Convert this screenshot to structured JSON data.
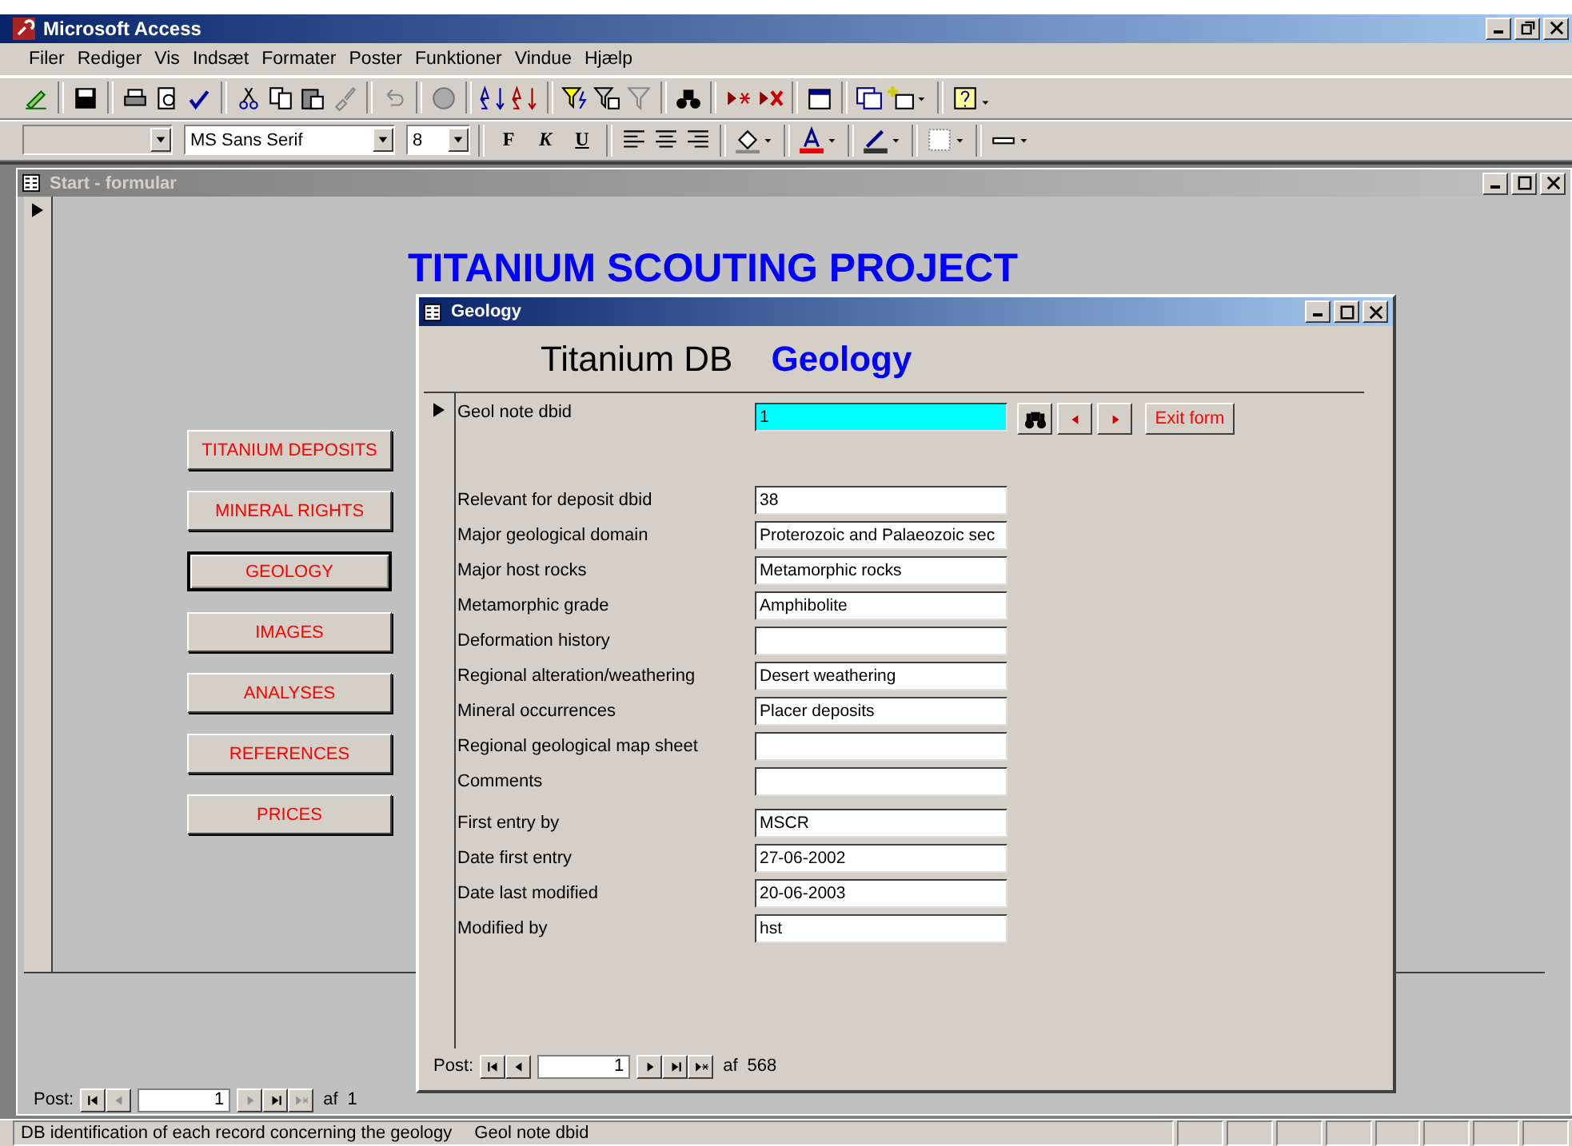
{
  "app_window": {
    "title": "Microsoft Access"
  },
  "menu": [
    "Filer",
    "Rediger",
    "Vis",
    "Indsæt",
    "Formater",
    "Poster",
    "Funktioner",
    "Vindue",
    "Hjælp"
  ],
  "format_toolbar": {
    "font": "MS Sans Serif",
    "size": "8",
    "style_buttons": [
      {
        "kind": "bold",
        "label": "F"
      },
      {
        "kind": "italic",
        "label": "K"
      },
      {
        "kind": "underline",
        "label": "U"
      }
    ]
  },
  "start_form": {
    "title": "Start - formular",
    "heading": "TITANIUM SCOUTING PROJECT",
    "buttons": [
      {
        "label": "TITANIUM DEPOSITS",
        "selected": false
      },
      {
        "label": "MINERAL RIGHTS",
        "selected": false
      },
      {
        "label": "GEOLOGY",
        "selected": true
      },
      {
        "label": "IMAGES",
        "selected": false
      },
      {
        "label": "ANALYSES",
        "selected": false
      },
      {
        "label": "REFERENCES",
        "selected": false
      },
      {
        "label": "PRICES",
        "selected": false
      }
    ],
    "navigator": {
      "label": "Post:",
      "record": "1",
      "of": "af",
      "total": "1",
      "buttons": [
        {
          "kind": "first",
          "disabled": false
        },
        {
          "kind": "prev",
          "disabled": true
        },
        {
          "kind": "next",
          "disabled": true
        },
        {
          "kind": "last",
          "disabled": false
        },
        {
          "kind": "new",
          "disabled": true
        }
      ]
    }
  },
  "geology_form": {
    "title": "Geology",
    "heading": "Titanium DB",
    "subheading": "Geology",
    "key_field": {
      "label": "Geol note dbid",
      "value": "1"
    },
    "exit_button": "Exit form",
    "fields": [
      {
        "label": "Relevant for deposit dbid",
        "value": "38"
      },
      {
        "label": "Major geological domain",
        "value": "Proterozoic and Palaeozoic sec"
      },
      {
        "label": "Major host rocks",
        "value": "Metamorphic rocks"
      },
      {
        "label": "Metamorphic grade",
        "value": "Amphibolite"
      },
      {
        "label": "Deformation history"
      },
      {
        "label": "Regional alteration/weathering",
        "value": "Desert weathering"
      },
      {
        "label": "Mineral occurrences",
        "value": "Placer deposits"
      },
      {
        "label": "Regional geological map sheet"
      },
      {
        "label": "Comments"
      },
      {
        "label": "First entry by",
        "value": "MSCR"
      },
      {
        "label": "Date first entry",
        "value": "27-06-2002"
      },
      {
        "label": "Date last modified",
        "value": "20-06-2003"
      },
      {
        "label": "Modified by",
        "value": "hst"
      }
    ],
    "navigator": {
      "label": "Post:",
      "record": "1",
      "of": "af",
      "total": "568",
      "buttons": [
        {
          "kind": "first",
          "disabled": false
        },
        {
          "kind": "prev",
          "disabled": false
        },
        {
          "kind": "next",
          "disabled": false
        },
        {
          "kind": "last",
          "disabled": false
        },
        {
          "kind": "new",
          "disabled": false
        }
      ]
    }
  },
  "status_bar": {
    "message": "DB identification of each record concerning the geology",
    "field": "Geol note dbid"
  }
}
